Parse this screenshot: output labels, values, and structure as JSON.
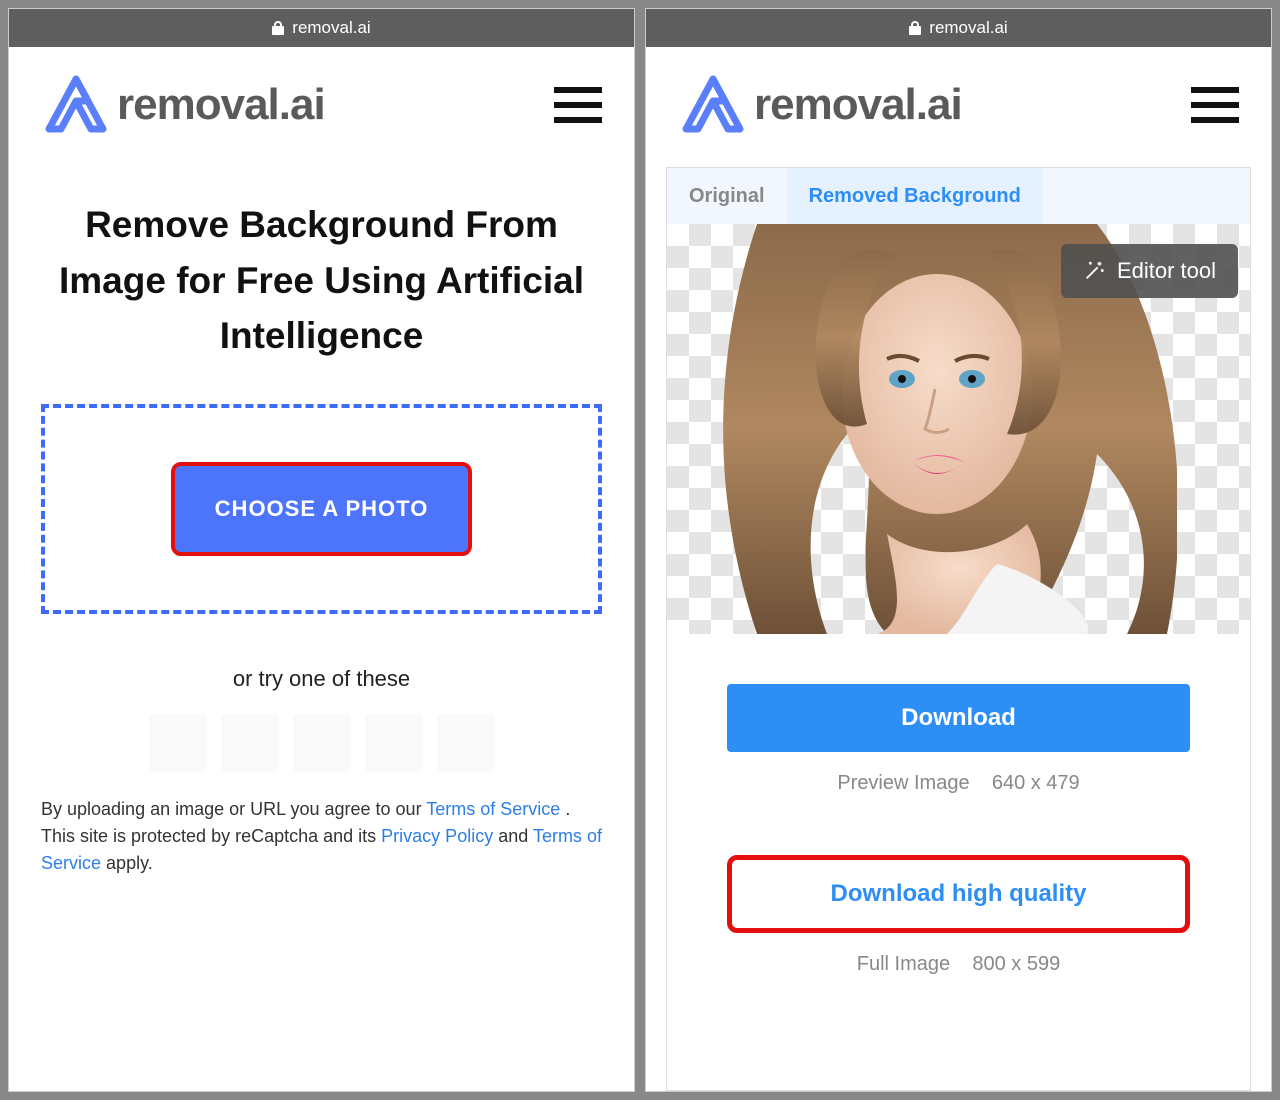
{
  "left": {
    "url": "removal.ai",
    "brand": "removal.ai",
    "title": "Remove Background From Image for Free Using Artificial Intelligence",
    "choose_label": "CHOOSE A PHOTO",
    "try_label": "or try one of these",
    "disclaimer_pre": "By uploading an image or URL you agree to our ",
    "tos": "Terms of Service",
    "disclaimer_mid1": " . This site is protected by reCaptcha and its ",
    "privacy": "Privacy Policy",
    "disclaimer_mid2": " and ",
    "tos2": "Terms of Service",
    "disclaimer_end": " apply."
  },
  "right": {
    "url": "removal.ai",
    "brand": "removal.ai",
    "tabs": {
      "original": "Original",
      "removed": "Removed Background"
    },
    "editor": "Editor tool",
    "download": "Download",
    "preview_meta_label": "Preview Image",
    "preview_meta_dims": "640 x 479",
    "download_hq": "Download high quality",
    "full_meta_label": "Full Image",
    "full_meta_dims": "800 x 599"
  }
}
